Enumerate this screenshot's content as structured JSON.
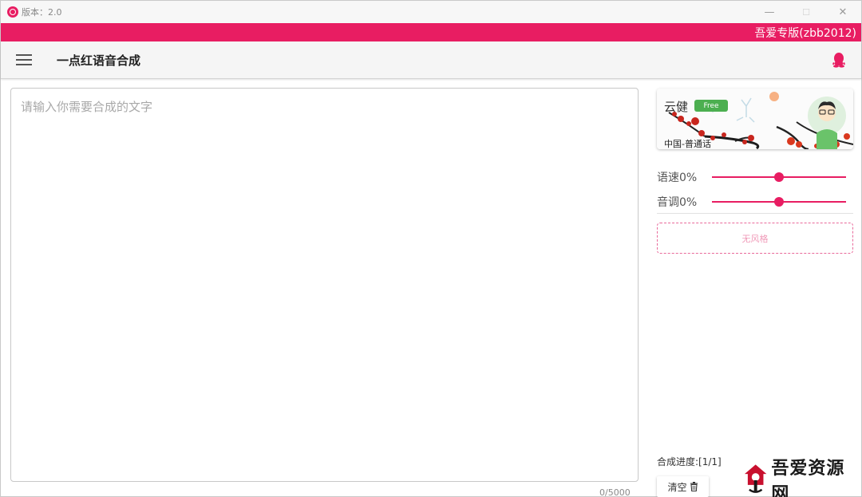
{
  "window": {
    "version_label": "版本：2.0",
    "controls": {
      "minimize": "—",
      "maximize": "☐",
      "close": "✕"
    }
  },
  "banner": {
    "text": "吾爱专版(zbb2012)"
  },
  "toolbar": {
    "title": "一点红语音合成",
    "menu_icon": "hamburger-icon",
    "right_icon": "qq-icon"
  },
  "editor": {
    "placeholder": "请输入你需要合成的文字",
    "value": "",
    "char_count": "0/5000"
  },
  "voice_card": {
    "name": "云健",
    "badge": "Free",
    "language": "中国-普通话"
  },
  "sliders": [
    {
      "label": "语速0%",
      "value": 0.5
    },
    {
      "label": "音调0%",
      "value": 0.5
    }
  ],
  "style_box": {
    "label": "无风格"
  },
  "progress": {
    "text": "合成进度:[1/1]"
  },
  "clear_button": {
    "label": "清空",
    "icon": "trash-icon"
  },
  "watermark": {
    "text": "吾爱资源网"
  },
  "colors": {
    "accent": "#e81d62",
    "badge_green": "#4caf50",
    "style_border": "#e9699a"
  }
}
